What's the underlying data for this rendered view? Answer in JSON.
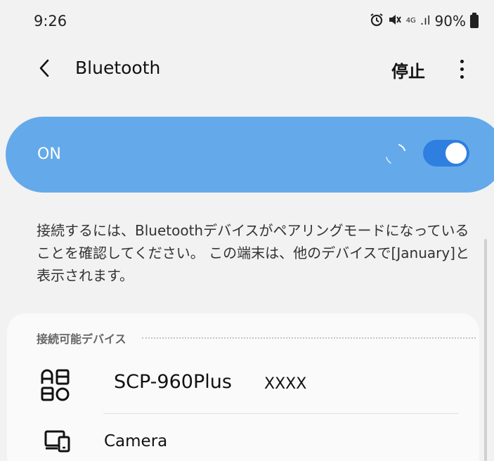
{
  "status_bar": {
    "time": "9:26",
    "network_label": "4G",
    "signal_text": ".ıl",
    "battery_percent": "90%",
    "icons": [
      "alarm-icon",
      "mute-icon",
      "4g-icon",
      "signal-icon",
      "battery-icon"
    ]
  },
  "app_bar": {
    "title": "Bluetooth",
    "stop_label": "停止"
  },
  "toggle": {
    "label": "ON",
    "state": true,
    "scanning": true,
    "accent_color": "#64aaea",
    "switch_color": "#2f7fe0"
  },
  "description": "接続するには、Bluetoothデバイスがペアリングモードになっていることを確認してください。 この端末は、他のデバイスで[January]と表示されます。",
  "available_devices": {
    "section_title": "接続可能デバイス",
    "devices": [
      {
        "name": "SCP-960Plus",
        "suffix": "XXXX",
        "icon": "device-generic-icon"
      },
      {
        "name": "Camera",
        "icon": "camera-device-icon"
      }
    ]
  }
}
